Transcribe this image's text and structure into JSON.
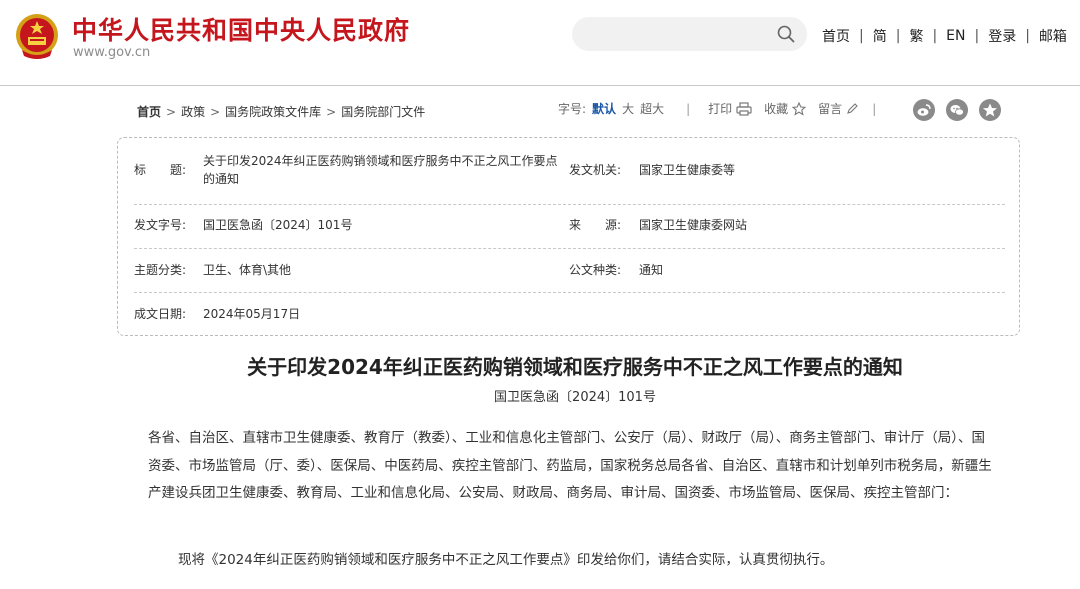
{
  "site": {
    "name": "中华人民共和国中央人民政府",
    "url": "www.gov.cn"
  },
  "top_nav": {
    "items": [
      "首页",
      "简",
      "繁",
      "EN",
      "登录",
      "邮箱"
    ]
  },
  "breadcrumb": [
    "首页",
    "政策",
    "国务院政策文件库",
    "国务院部门文件"
  ],
  "toolbar": {
    "font_size_label": "字号:",
    "sizes": [
      "默认",
      "大",
      "超大"
    ],
    "print": "打印",
    "favorite": "收藏",
    "comment": "留言"
  },
  "info": {
    "title_label": "标　　题:",
    "title_value": "关于印发2024年纠正医药购销领域和医疗服务中不正之风工作要点的通知",
    "issuer_label": "发文机关:",
    "issuer_value": "国家卫生健康委等",
    "doc_no_label": "发文字号:",
    "doc_no_value": "国卫医急函〔2024〕101号",
    "source_label": "来　　源:",
    "source_value": "国家卫生健康委网站",
    "category_label": "主题分类:",
    "category_value": "卫生、体育\\其他",
    "doc_type_label": "公文种类:",
    "doc_type_value": "通知",
    "date_label": "成文日期:",
    "date_value": "2024年05月17日"
  },
  "article": {
    "title": "关于印发2024年纠正医药购销领域和医疗服务中不正之风工作要点的通知",
    "number": "国卫医急函〔2024〕101号",
    "addressee": "各省、自治区、直辖市卫生健康委、教育厅（教委）、工业和信息化主管部门、公安厅（局）、财政厅（局）、商务主管部门、审计厅（局）、国资委、市场监管局（厅、委）、医保局、中医药局、疾控主管部门、药监局，国家税务总局各省、自治区、直辖市和计划单列市税务局，新疆生产建设兵团卫生健康委、教育局、工业和信息化局、公安局、财政局、商务局、审计局、国资委、市场监管局、医保局、疾控主管部门：",
    "paragraph": "现将《2024年纠正医药购销领域和医疗服务中不正之风工作要点》印发给你们，请结合实际，认真贯彻执行。"
  },
  "colors": {
    "brand_red": "#c4161c",
    "link_blue": "#1a57a6",
    "share_gray": "#8a8a8a"
  },
  "icons": [
    "national-emblem-icon",
    "search-icon",
    "print-icon",
    "star-icon",
    "pencil-icon",
    "weibo-icon",
    "wechat-icon",
    "qzone-icon"
  ]
}
